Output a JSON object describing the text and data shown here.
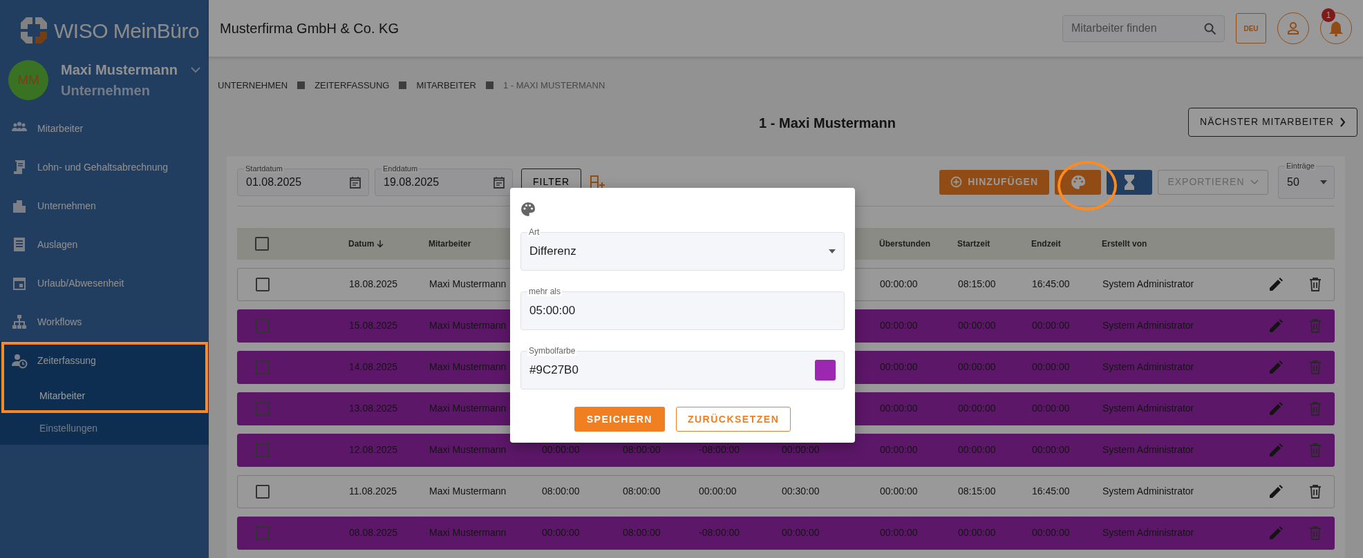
{
  "sidebar": {
    "logo": "WISO MeinBüro",
    "user": {
      "initials": "MM",
      "name": "Maxi Mustermann",
      "subtitle": "Unternehmen"
    },
    "items": [
      {
        "label": "Mitarbeiter",
        "selected": false
      },
      {
        "label": "Lohn- und Gehaltsabrechnung",
        "selected": false
      },
      {
        "label": "Unternehmen",
        "selected": false
      },
      {
        "label": "Auslagen",
        "selected": false
      },
      {
        "label": "Urlaub/Abwesenheit",
        "selected": false
      },
      {
        "label": "Workflows",
        "selected": false
      },
      {
        "label": "Zeiterfassung",
        "selected": true,
        "expanded": true,
        "children": [
          {
            "label": "Mitarbeiter",
            "selected": true
          },
          {
            "label": "Einstellungen",
            "selected": false
          }
        ]
      }
    ]
  },
  "header": {
    "company": "Musterfirma GmbH & Co. KG",
    "search": {
      "placeholder": "Mitarbeiter finden"
    },
    "language": "DEU",
    "notifications": "1"
  },
  "breadcrumb": [
    {
      "label": "UNTERNEHMEN",
      "current": false
    },
    {
      "label": "ZEITERFASSUNG",
      "current": false
    },
    {
      "label": "MITARBEITER",
      "current": false
    },
    {
      "label": "1 - MAXI MUSTERMANN",
      "current": true
    }
  ],
  "page_title": "1 - Maxi Mustermann",
  "next_button": "NÄCHSTER MITARBEITER",
  "filters": [
    {
      "label": "Startdatum",
      "value": "01.08.2025"
    },
    {
      "label": "Enddatum",
      "value": "19.08.2025"
    }
  ],
  "filter_button": "FILTER",
  "toolbar": {
    "add_button": "HINZUFÜGEN",
    "export_button": {
      "label": "EXPORTIEREN",
      "disabled": true
    },
    "entries": {
      "label": "Einträge",
      "value": "50"
    }
  },
  "table": {
    "select_all": {
      "checked": false
    },
    "columns": [
      {
        "label": "Datum",
        "sorted": true
      },
      {
        "label": "Mitarbeiter",
        "sorted": false
      },
      {},
      {},
      {},
      {},
      {
        "label": "Überstunden",
        "sorted": false
      },
      {
        "label": "Startzeit",
        "sorted": false
      },
      {
        "label": "Endzeit",
        "sorted": false
      },
      {
        "label": "Erstellt von",
        "sorted": false
      }
    ],
    "rows": [
      {
        "checked": false,
        "highlighted": false,
        "cells": [
          "18.08.2025",
          "Maxi Mustermann",
          "",
          "",
          "",
          "",
          "00:00:00",
          "08:15:00",
          "16:45:00",
          "System Administrator"
        ]
      },
      {
        "checked": false,
        "highlighted": true,
        "cells": [
          "15.08.2025",
          "Maxi Mustermann",
          "",
          "",
          "",
          "",
          "00:00:00",
          "00:00:00",
          "00:00:00",
          "System Administrator"
        ]
      },
      {
        "checked": false,
        "highlighted": true,
        "cells": [
          "14.08.2025",
          "Maxi Mustermann",
          "",
          "",
          "",
          "",
          "00:00:00",
          "00:00:00",
          "00:00:00",
          "System Administrator"
        ]
      },
      {
        "checked": false,
        "highlighted": true,
        "cells": [
          "13.08.2025",
          "Maxi Mustermann",
          "",
          "",
          "",
          "",
          "00:00:00",
          "00:00:00",
          "00:00:00",
          "System Administrator"
        ]
      },
      {
        "checked": false,
        "highlighted": true,
        "cells": [
          "12.08.2025",
          "Maxi Mustermann",
          "00:00:00",
          "08:00:00",
          "-08:00:00",
          "00:00:00",
          "00:00:00",
          "00:00:00",
          "00:00:00",
          "System Administrator"
        ]
      },
      {
        "checked": false,
        "highlighted": false,
        "cells": [
          "11.08.2025",
          "Maxi Mustermann",
          "08:00:00",
          "08:00:00",
          "00:00:00",
          "00:30:00",
          "00:00:00",
          "08:15:00",
          "16:45:00",
          "System Administrator"
        ]
      },
      {
        "checked": false,
        "highlighted": true,
        "cells": [
          "08.08.2025",
          "Maxi Mustermann",
          "00:00:00",
          "08:00:00",
          "-08:00:00",
          "00:00:00",
          "00:00:00",
          "00:00:00",
          "00:00:00",
          "System Administrator"
        ]
      }
    ]
  },
  "dialog": {
    "fields": [
      {
        "kind": "select",
        "label": "Art",
        "value": "Differenz"
      },
      {
        "kind": "text",
        "label": "mehr als",
        "value": "05:00:00"
      },
      {
        "kind": "color",
        "label": "Symbolfarbe",
        "value": "#9C27B0",
        "color": "#9c27b0"
      }
    ],
    "buttons": [
      {
        "kind": "primary",
        "label": "SPEICHERN"
      },
      {
        "kind": "outline",
        "label": "ZURÜCKSETZEN"
      }
    ]
  }
}
